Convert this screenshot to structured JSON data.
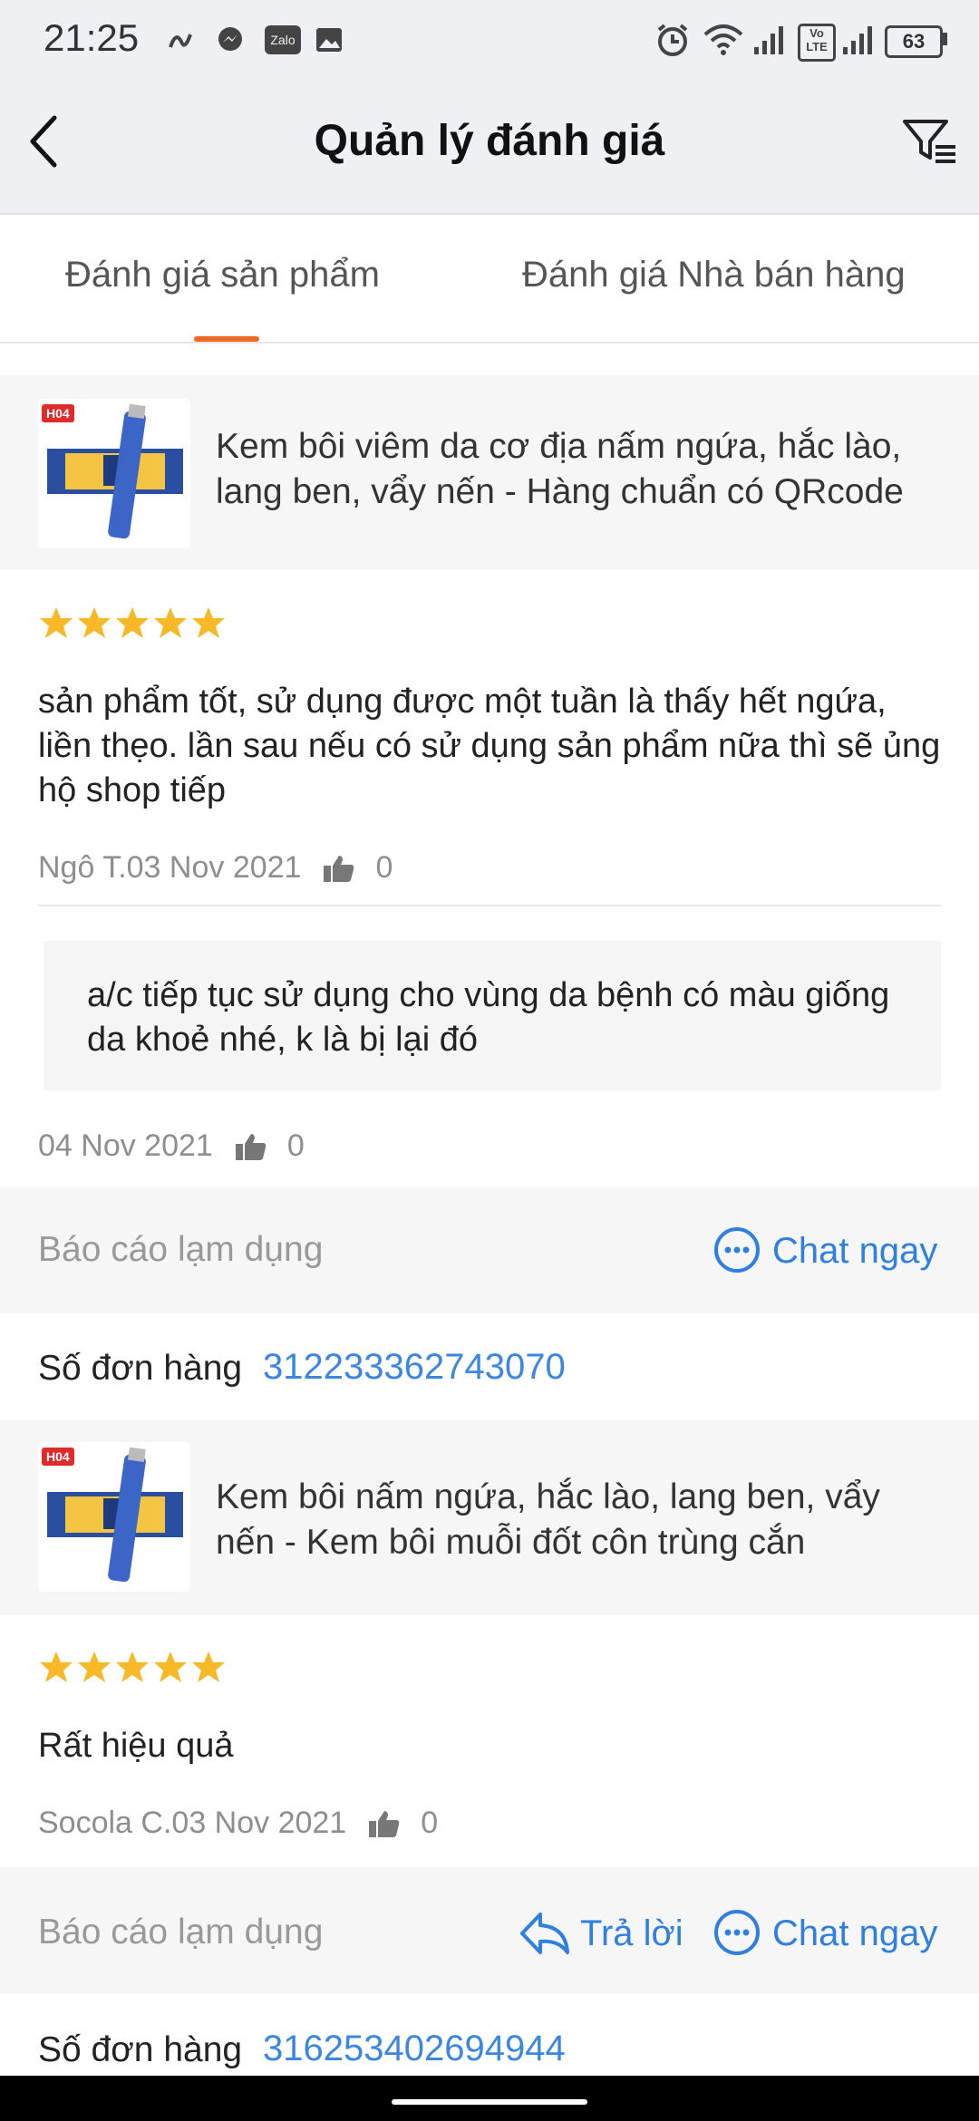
{
  "status_bar": {
    "time": "21:25",
    "left_icons": [
      "signal-app-icon",
      "messenger-icon",
      "zalo-icon",
      "gallery-icon"
    ],
    "zalo_label": "Zalo",
    "right_icons": [
      "alarm-icon",
      "wifi-icon",
      "cell-signal-icon",
      "volte-icon",
      "cell-signal-icon",
      "battery-icon"
    ],
    "volte_label": "Vo LTE",
    "battery": "63"
  },
  "header": {
    "title": "Quản lý đánh giá",
    "back_icon": "back-arrow-icon",
    "filter_icon": "filter-icon"
  },
  "tabs": [
    {
      "label": "Đánh giá sản phẩm",
      "active": true
    },
    {
      "label": "Đánh giá Nhà bán hàng",
      "active": false
    }
  ],
  "reviews": [
    {
      "product": {
        "badge": "H04",
        "name": "Kem bôi viêm da cơ địa nấm ngứa, hắc lào, lang ben, vẩy nến - Hàng chuẩn có QRcode"
      },
      "rating": 5,
      "text": "sản phẩm tốt,  sử dụng được một tuần là thấy hết ngứa, liền thẹo. lần sau nếu có sử dụng sản phẩm nữa thì sẽ ủng hộ shop tiếp",
      "author_date": "Ngô T.03 Nov 2021",
      "likes": "0",
      "reply": {
        "text": "a/c tiếp tục sử dụng cho vùng da bệnh có màu giống da khoẻ nhé, k là bị lại đó",
        "date": "04 Nov 2021",
        "likes": "0"
      },
      "actions": {
        "report": "Báo cáo lạm dụng",
        "chat": "Chat ngay"
      },
      "order_label": "Số đơn hàng",
      "order_number": "312233362743070"
    },
    {
      "product": {
        "badge": "H04",
        "name": "Kem bôi nấm ngứa, hắc lào, lang ben, vẩy nến - Kem bôi muỗi đốt côn trùng cắn"
      },
      "rating": 5,
      "text": "Rất hiệu quả",
      "author_date": "Socola C.03 Nov 2021",
      "likes": "0",
      "actions": {
        "report": "Báo cáo lạm dụng",
        "reply": "Trả lời",
        "chat": "Chat ngay"
      },
      "order_label": "Số đơn hàng",
      "order_number": "316253402694944"
    }
  ],
  "colors": {
    "accent": "#ee6a24",
    "link": "#2f7fe0",
    "star": "#f7b928",
    "muted": "#8e8e8e"
  }
}
